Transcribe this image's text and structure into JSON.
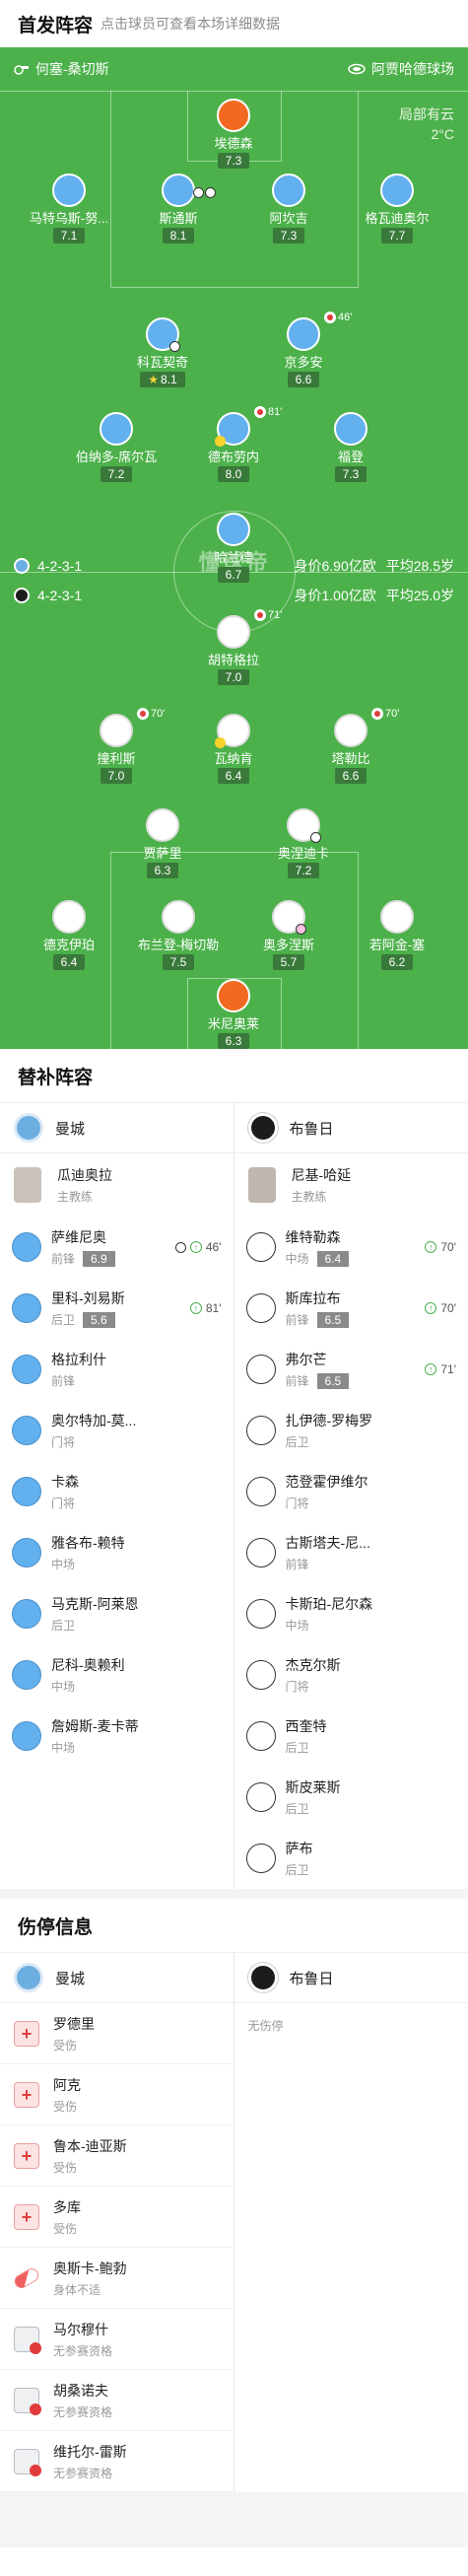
{
  "lineup": {
    "title": "首发阵容",
    "subtitle": "点击球员可查看本场详细数据",
    "venue_left": "何塞-桑切斯",
    "venue_right": "阿贾哈德球场",
    "weather": "局部有云",
    "temperature": "2°C",
    "watermark": "懂球帝",
    "home_formation": "4-2-3-1",
    "home_meta_value": "身价6.90亿欧",
    "home_meta_age": "平均28.5岁",
    "away_formation": "4-2-3-1",
    "away_meta_value": "身价1.00亿欧",
    "away_meta_age": "平均25.0岁",
    "home_players": [
      {
        "name": "埃德森",
        "rating": "7.3"
      },
      {
        "name": "马特乌斯-努...",
        "rating": "7.1"
      },
      {
        "name": "斯通斯",
        "rating": "8.1"
      },
      {
        "name": "阿坎吉",
        "rating": "7.3"
      },
      {
        "name": "格瓦迪奥尔",
        "rating": "7.7"
      },
      {
        "name": "科瓦契奇",
        "rating": "8.1"
      },
      {
        "name": "京多安",
        "rating": "6.6",
        "event": "46'"
      },
      {
        "name": "伯纳多-席尔瓦",
        "rating": "7.2"
      },
      {
        "name": "德布劳内",
        "rating": "8.0",
        "event": "81'"
      },
      {
        "name": "福登",
        "rating": "7.3"
      },
      {
        "name": "哈兰德",
        "rating": "6.7"
      }
    ],
    "away_players": [
      {
        "name": "胡特格拉",
        "rating": "7.0",
        "event": "71'"
      },
      {
        "name": "撞利斯",
        "rating": "7.0",
        "event": "70'"
      },
      {
        "name": "瓦纳肯",
        "rating": "6.4"
      },
      {
        "name": "塔勒比",
        "rating": "6.6",
        "event": "70'"
      },
      {
        "name": "贾萨里",
        "rating": "6.3"
      },
      {
        "name": "奥涅迪卡",
        "rating": "7.2"
      },
      {
        "name": "德克伊珀",
        "rating": "6.4"
      },
      {
        "name": "布兰登-梅切勒",
        "rating": "7.5"
      },
      {
        "name": "奥多涅斯",
        "rating": "5.7"
      },
      {
        "name": "若阿金-塞",
        "rating": "6.2"
      },
      {
        "name": "米尼奥莱",
        "rating": "6.3"
      }
    ]
  },
  "subs": {
    "title": "替补阵容",
    "home_team": "曼城",
    "away_team": "布鲁日",
    "home_coach": {
      "name": "瓜迪奥拉",
      "role": "主教练"
    },
    "away_coach": {
      "name": "尼基-哈延",
      "role": "主教练"
    },
    "home": [
      {
        "name": "萨维尼奥",
        "pos": "前锋",
        "rating": "6.9",
        "event": "46'"
      },
      {
        "name": "里科-刘易斯",
        "pos": "后卫",
        "rating": "5.6",
        "event": "81'"
      },
      {
        "name": "格拉利什",
        "pos": "前锋"
      },
      {
        "name": "奥尔特加-莫...",
        "pos": "门将"
      },
      {
        "name": "卡森",
        "pos": "门将"
      },
      {
        "name": "雅各布-赖特",
        "pos": "中场"
      },
      {
        "name": "马克斯-阿莱恩",
        "pos": "后卫"
      },
      {
        "name": "尼科-奥赖利",
        "pos": "中场"
      },
      {
        "name": "詹姆斯-麦卡蒂",
        "pos": "中场"
      }
    ],
    "away": [
      {
        "name": "维特勒森",
        "pos": "中场",
        "rating": "6.4",
        "event": "70'"
      },
      {
        "name": "斯库拉布",
        "pos": "前锋",
        "rating": "6.5",
        "event": "70'"
      },
      {
        "name": "弗尔芒",
        "pos": "前锋",
        "rating": "6.5",
        "event": "71'"
      },
      {
        "name": "扎伊德-罗梅罗",
        "pos": "后卫"
      },
      {
        "name": "范登霍伊维尔",
        "pos": "门将"
      },
      {
        "name": "古斯塔夫-尼...",
        "pos": "前锋"
      },
      {
        "name": "卡斯珀-尼尔森",
        "pos": "中场"
      },
      {
        "name": "杰克尔斯",
        "pos": "门将"
      },
      {
        "name": "西奎特",
        "pos": "后卫"
      },
      {
        "name": "斯皮莱斯",
        "pos": "后卫"
      },
      {
        "name": "萨布",
        "pos": "后卫"
      }
    ]
  },
  "injuries": {
    "title": "伤停信息",
    "home_team": "曼城",
    "away_team": "布鲁日",
    "away_empty": "无伤停",
    "home": [
      {
        "name": "罗德里",
        "reason": "受伤",
        "icon": "medkit-icon"
      },
      {
        "name": "阿克",
        "reason": "受伤",
        "icon": "medkit-icon"
      },
      {
        "name": "鲁本-迪亚斯",
        "reason": "受伤",
        "icon": "medkit-icon"
      },
      {
        "name": "多库",
        "reason": "受伤",
        "icon": "medkit-icon"
      },
      {
        "name": "奥斯卡-鲍勃",
        "reason": "身体不适",
        "icon": "pill-icon"
      },
      {
        "name": "马尔穆什",
        "reason": "无参赛资格",
        "icon": "ineligible-icon"
      },
      {
        "name": "胡桑诺夫",
        "reason": "无参赛资格",
        "icon": "ineligible-icon"
      },
      {
        "name": "维托尔-雷斯",
        "reason": "无参赛资格",
        "icon": "ineligible-icon"
      }
    ]
  },
  "colors": {
    "pitch": "#4cb14a",
    "home_shirt": "#63b0ef",
    "away_shirt": "#ffffff",
    "goalkeeper": "#f26a21"
  }
}
